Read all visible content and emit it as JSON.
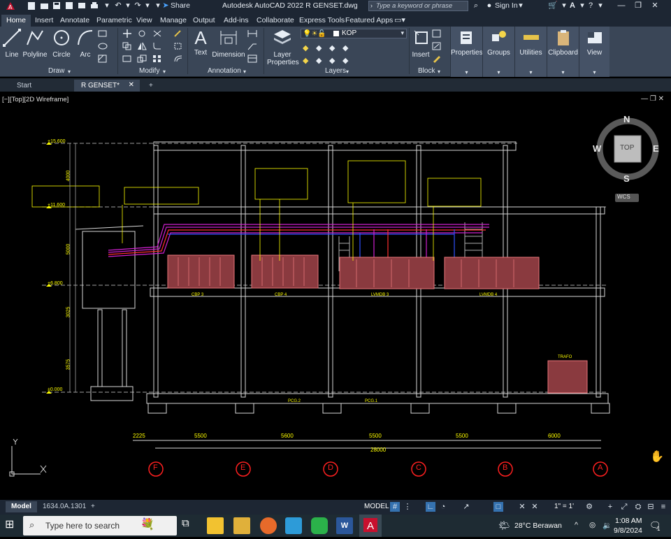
{
  "window": {
    "title": "Autodesk AutoCAD 2022    R GENSET.dwg",
    "search_placeholder": "Type a keyword or phrase",
    "share_label": "Share",
    "sign_in_label": "Sign In"
  },
  "ribbon_tabs": [
    "Home",
    "Insert",
    "Annotate",
    "Parametric",
    "View",
    "Manage",
    "Output",
    "Add-ins",
    "Collaborate",
    "Express Tools",
    "Featured Apps"
  ],
  "ribbon": {
    "draw": {
      "title": "Draw",
      "tools": [
        "Line",
        "Polyline",
        "Circle",
        "Arc"
      ]
    },
    "modify": {
      "title": "Modify"
    },
    "annotation": {
      "title": "Annotation",
      "tools": [
        "Text",
        "Dimension"
      ]
    },
    "layers": {
      "title": "Layers",
      "tool": "Layer Properties",
      "tool_line1": "Layer",
      "tool_line2": "Properties",
      "current_layer": "KOP"
    },
    "block": {
      "title": "Block",
      "tool": "Insert"
    },
    "side_panels": [
      "Properties",
      "Groups",
      "Utilities",
      "Clipboard",
      "View"
    ]
  },
  "file_tabs": [
    "Start",
    "R GENSET*"
  ],
  "viewport": {
    "label": "[−][Top][2D Wireframe]",
    "viewcube": {
      "top": "TOP",
      "n": "N",
      "s": "S",
      "e": "E",
      "w": "W",
      "wcs": "WCS"
    }
  },
  "drawing": {
    "levels": [
      "+15.600",
      "+11.600",
      "+6.800",
      "±0.000"
    ],
    "vertical_dims": [
      "4000",
      "5000",
      "3025",
      "3575"
    ],
    "horizontal_dims": [
      "2225",
      "5500",
      "5600",
      "5500",
      "5500",
      "6000"
    ],
    "total_dim": "28000",
    "grid_labels": [
      "F",
      "E",
      "D",
      "C",
      "B",
      "A"
    ],
    "room_labels": [
      "CBP 3",
      "CBP 4",
      "LVMDB 3",
      "LVMDB 4"
    ],
    "pcg_labels": [
      "PCG.2",
      "PCG.1"
    ],
    "trafo_label": "TRAFO"
  },
  "status": {
    "layout_tabs": [
      "Model",
      "1634.0A.1301"
    ],
    "model_label": "MODEL",
    "scale": "1\" = 1'"
  },
  "taskbar": {
    "search_placeholder": "Type here to search",
    "weather": "28°C  Berawan",
    "time": "1:08 AM",
    "date": "9/8/2024",
    "notification_count": "1"
  },
  "colors": {
    "ribbon_bg": "#3a4657",
    "title_bg": "#1d2633",
    "drawing_bg": "#000000",
    "structure": "#d8d8d8",
    "equipment": "#e8757a",
    "annotation": "#ffff00",
    "cable_magenta": "#d020d0",
    "grid_bubble": "#ff2020"
  }
}
